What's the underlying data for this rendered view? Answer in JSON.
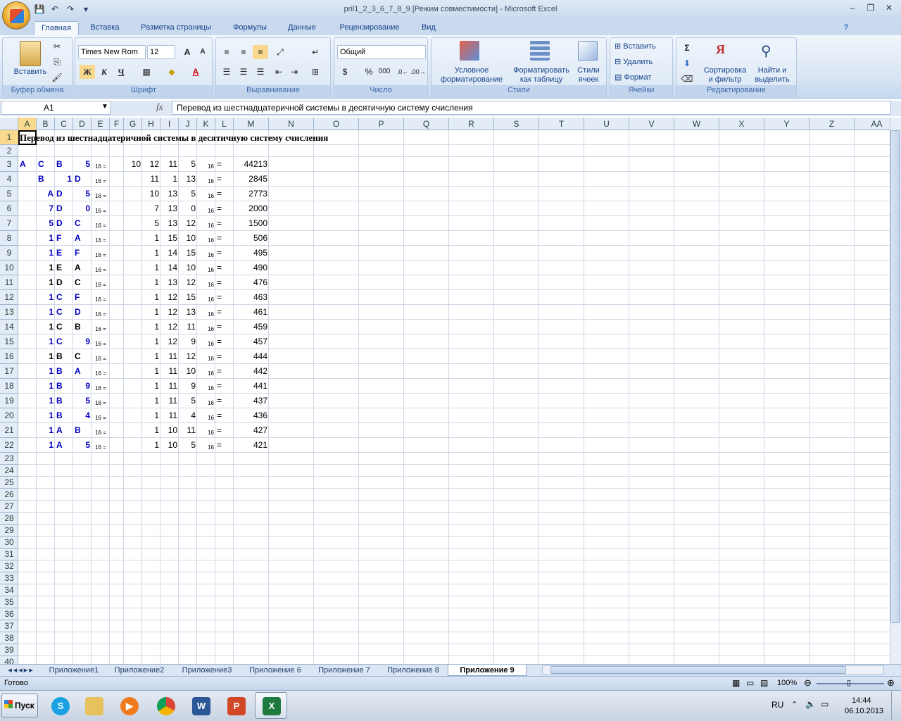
{
  "window": {
    "title": "pril1_2_3_6_7_8_9  [Режим совместимости] - Microsoft Excel"
  },
  "tabs": [
    "Главная",
    "Вставка",
    "Разметка страницы",
    "Формулы",
    "Данные",
    "Рецензирование",
    "Вид"
  ],
  "ribbon": {
    "clipboard": {
      "label": "Буфер обмена",
      "paste": "Вставить"
    },
    "font": {
      "label": "Шрифт",
      "name": "Times New Rom",
      "size": "12",
      "bold": "Ж",
      "italic": "К",
      "underline": "Ч"
    },
    "alignment": {
      "label": "Выравнивание"
    },
    "number": {
      "label": "Число",
      "format": "Общий",
      "percent": "%",
      "thousands": "000"
    },
    "styles": {
      "label": "Стили",
      "cond1": "Условное",
      "cond2": "форматирование",
      "table1": "Форматировать",
      "table2": "как таблицу",
      "cell1": "Стили",
      "cell2": "ячеек"
    },
    "cells": {
      "label": "Ячейки",
      "insert": "Вставить",
      "delete": "Удалить",
      "format": "Формат"
    },
    "editing": {
      "label": "Редактирование",
      "sort1": "Сортировка",
      "sort2": "и фильтр",
      "find1": "Найти и",
      "find2": "выделить"
    }
  },
  "formula_bar": {
    "name_box": "A1",
    "fx": "fx",
    "content": "Перевод из шестнадцатеричной системы в десятичную систему счисления"
  },
  "columns": [
    "A",
    "B",
    "C",
    "D",
    "E",
    "F",
    "G",
    "H",
    "I",
    "J",
    "K",
    "L",
    "M",
    "N",
    "O",
    "P",
    "Q",
    "R",
    "S",
    "T",
    "U",
    "V",
    "W",
    "X",
    "Y",
    "Z",
    "AA"
  ],
  "rows": [
    "1",
    "2",
    "3",
    "4",
    "5",
    "6",
    "7",
    "8",
    "9",
    "10",
    "11",
    "12",
    "13",
    "14",
    "15",
    "16",
    "17",
    "18",
    "19",
    "20",
    "21",
    "22",
    "23",
    "24",
    "25",
    "26",
    "27",
    "28",
    "29",
    "30",
    "31",
    "32",
    "33",
    "34",
    "35",
    "36",
    "37",
    "38",
    "39",
    "40"
  ],
  "sheet": {
    "title": "Перевод из шестнадцатеричной системы в десятичную систему счисления",
    "sub16": "16",
    "eq": "=",
    "data": [
      {
        "a": "A",
        "b": "C",
        "c": "B",
        "d": "5",
        "g": "10",
        "h": "12",
        "i": "11",
        "j": "5",
        "m": "44213",
        "color": "blue"
      },
      {
        "a": "",
        "b": "B",
        "c": "",
        "d": "1",
        "d2": "D",
        "g": "",
        "h": "11",
        "i": "1",
        "j": "13",
        "m": "2845",
        "color": "blue",
        "special": "b1d"
      },
      {
        "a": "",
        "b": "A",
        "c": "D",
        "d": "5",
        "h": "10",
        "i": "13",
        "j": "5",
        "m": "2773",
        "color": "blue",
        "shift": true
      },
      {
        "b": "7",
        "c": "D",
        "d": "0",
        "h": "7",
        "i": "13",
        "j": "0",
        "m": "2000",
        "color": "blue"
      },
      {
        "b": "5",
        "c": "D",
        "d": "C",
        "h": "5",
        "i": "13",
        "j": "12",
        "m": "1500",
        "color": "blue"
      },
      {
        "b": "1",
        "c": "F",
        "d": "A",
        "h": "1",
        "i": "15",
        "j": "10",
        "m": "506",
        "color": "blue"
      },
      {
        "b": "1",
        "c": "E",
        "d": "F",
        "h": "1",
        "i": "14",
        "j": "15",
        "m": "495",
        "color": "blue"
      },
      {
        "b": "1",
        "c": "E",
        "d": "A",
        "h": "1",
        "i": "14",
        "j": "10",
        "m": "490",
        "color": "black"
      },
      {
        "b": "1",
        "c": "D",
        "d": "C",
        "h": "1",
        "i": "13",
        "j": "12",
        "m": "476",
        "color": "black"
      },
      {
        "b": "1",
        "c": "C",
        "d": "F",
        "h": "1",
        "i": "12",
        "j": "15",
        "m": "463",
        "color": "blue"
      },
      {
        "b": "1",
        "c": "C",
        "d": "D",
        "h": "1",
        "i": "12",
        "j": "13",
        "m": "461",
        "color": "blue"
      },
      {
        "b": "1",
        "c": "C",
        "d": "B",
        "h": "1",
        "i": "12",
        "j": "11",
        "m": "459",
        "color": "black"
      },
      {
        "b": "1",
        "c": "C",
        "d": "9",
        "h": "1",
        "i": "12",
        "j": "9",
        "m": "457",
        "color": "blue"
      },
      {
        "b": "1",
        "c": "B",
        "d": "C",
        "h": "1",
        "i": "11",
        "j": "12",
        "m": "444",
        "color": "black"
      },
      {
        "b": "1",
        "c": "B",
        "d": "A",
        "h": "1",
        "i": "11",
        "j": "10",
        "m": "442",
        "color": "blue"
      },
      {
        "b": "1",
        "c": "B",
        "d": "9",
        "h": "1",
        "i": "11",
        "j": "9",
        "m": "441",
        "color": "blue"
      },
      {
        "b": "1",
        "c": "B",
        "d": "5",
        "h": "1",
        "i": "11",
        "j": "5",
        "m": "437",
        "color": "blue"
      },
      {
        "b": "1",
        "c": "B",
        "d": "4",
        "h": "1",
        "i": "11",
        "j": "4",
        "m": "436",
        "color": "blue"
      },
      {
        "b": "1",
        "c": "A",
        "d": "B",
        "h": "1",
        "i": "10",
        "j": "11",
        "m": "427",
        "color": "blue"
      },
      {
        "b": "1",
        "c": "A",
        "d": "5",
        "h": "1",
        "i": "10",
        "j": "5",
        "m": "421",
        "color": "blue"
      }
    ]
  },
  "sheet_tabs": [
    "Приложение1",
    "Приложение2",
    "Приложение3",
    "Приложение 6",
    "Приложение 7",
    "Приложение 8",
    "Приложение 9"
  ],
  "status": {
    "ready": "Готово",
    "zoom": "100%"
  },
  "taskbar": {
    "start": "Пуск",
    "lang": "RU",
    "time": "14:44",
    "date": "06.10.2013"
  },
  "colors": {
    "accent": "#15428b",
    "cell_blue": "#0000c0",
    "selection": "#f8d98d"
  }
}
